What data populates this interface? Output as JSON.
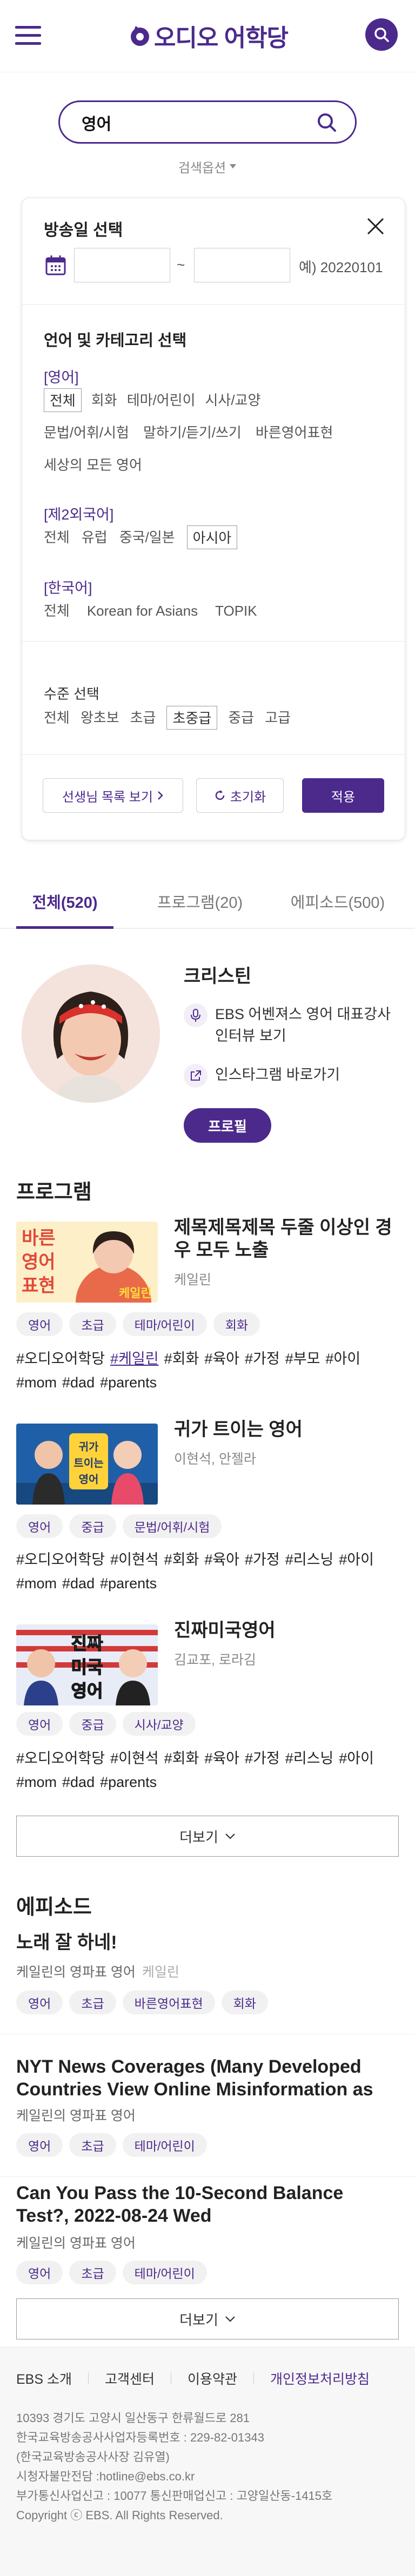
{
  "header": {
    "logo_text": "오디오 어학당",
    "menu_icon": "hamburger-icon",
    "search_icon": "search-icon"
  },
  "search": {
    "query": "영어",
    "placeholder": "",
    "options_label": "검색옵션"
  },
  "filter": {
    "broadcast_title": "방송일 선택",
    "date_from": "",
    "date_to": "",
    "tilde": "~",
    "date_hint": "예) 20220101",
    "lang_title": "언어 및 카테고리 선택",
    "groups": [
      {
        "label": "[영어]",
        "rows": [
          [
            "전체",
            "회화",
            "테마/어린이",
            "시사/교양"
          ],
          [
            "문법/어휘/시험",
            "말하기/듣기/쓰기",
            "바른영어표현"
          ],
          [
            "세상의 모든 영어"
          ]
        ]
      },
      {
        "label": "[제2외국어]",
        "rows": [
          [
            "전체",
            "유럽",
            "중국/일본",
            "아시아"
          ]
        ]
      },
      {
        "label": "[한국어]",
        "rows": [
          [
            "전체",
            "Korean for Asians",
            "TOPIK"
          ]
        ]
      }
    ],
    "level_title": "수준 선택",
    "levels": [
      "전체",
      "왕초보",
      "초급",
      "초중급",
      "중급",
      "고급"
    ],
    "teacher_list_button": "선생님 목록 보기",
    "reset_button": "초기화",
    "apply_button": "적용"
  },
  "tabs": [
    "전체(520)",
    "프로그램(20)",
    "에피소드(500)"
  ],
  "profile": {
    "name": "크리스틴",
    "link1": "EBS 어벤져스 영어 대표강사 인터뷰 보기",
    "link2": "인스타그램 바로가기",
    "button": "프로필"
  },
  "programs_heading": "프로그램",
  "programs": [
    {
      "title": "제목제목제목 두줄 이상인 경우 모두 노출",
      "author": "케일린",
      "thumb_text": [
        "바른",
        "영어",
        "표현"
      ],
      "thumb_name": "케일린",
      "chips": [
        "영어",
        "초급",
        "테마/어린이",
        "회화"
      ],
      "tags": [
        "#오디오어학당",
        "#케일린",
        "#회화",
        "#육아",
        "#가정",
        "#부모",
        "#아이",
        "#mom",
        "#dad",
        "#parents"
      ],
      "highlight": "#케일린"
    },
    {
      "title": "귀가 트이는 영어",
      "author": "이현석, 안젤라",
      "thumb_text": [
        "귀가",
        "트이는",
        "영어"
      ],
      "chips": [
        "영어",
        "중급",
        "문법/어휘/시험"
      ],
      "tags": [
        "#오디오어학당",
        "#이현석",
        "#회화",
        "#육아",
        "#가정",
        "#리스닝",
        "#아이",
        "#mom",
        "#dad",
        "#parents"
      ]
    },
    {
      "title": "진짜미국영어",
      "author": "김교포, 로라김",
      "thumb_text": [
        "진짜",
        "미국",
        "영어"
      ],
      "chips": [
        "영어",
        "중급",
        "시사/교양"
      ],
      "tags": [
        "#오디오어학당",
        "#이현석",
        "#회화",
        "#육아",
        "#가정",
        "#리스닝",
        "#아이",
        "#mom",
        "#dad",
        "#parents"
      ]
    }
  ],
  "more_label": "더보기",
  "episodes_heading": "에피소드",
  "episodes": [
    {
      "title": "노래 잘 하네!",
      "program": "케일린의 영파표 영어",
      "author": "케일린",
      "chips": [
        "영어",
        "초급",
        "바른영어표현",
        "회화"
      ]
    },
    {
      "title": "NYT News Coverages (Many Developed Countries View Online Misinformation as ‘Major…",
      "program": "케일린의 영파표 영어",
      "author": "",
      "chips": [
        "영어",
        "초급",
        "테마/어린이"
      ]
    },
    {
      "title": "Can You Pass the 10-Second Balance Test?, 2022-08-24 Wed",
      "program": "케일린의 영파표 영어",
      "author": "",
      "chips": [
        "영어",
        "초급",
        "테마/어린이"
      ]
    }
  ],
  "footer": {
    "links": [
      "EBS 소개",
      "고객센터",
      "이용약관",
      "개인정보처리방침"
    ],
    "lines": [
      "10393 경기도 고양시 일산동구 한류월드로 281",
      "한국교육방송공사사업자등록번호 : 229-82-01343",
      "(한국교육방송공사사장 김유열)",
      "시청자불만전담 :hotline@ebs.co.kr",
      "부가통신사업신고 : 10077 통신판매업신고 : 고양일산동-1415호",
      "Copyright ⓒ EBS. All Rights Reserved."
    ]
  },
  "colors": {
    "accent": "#4b2a8c",
    "chip_bg": "#f1f1f1",
    "footer_bg": "#f7f7f7"
  }
}
